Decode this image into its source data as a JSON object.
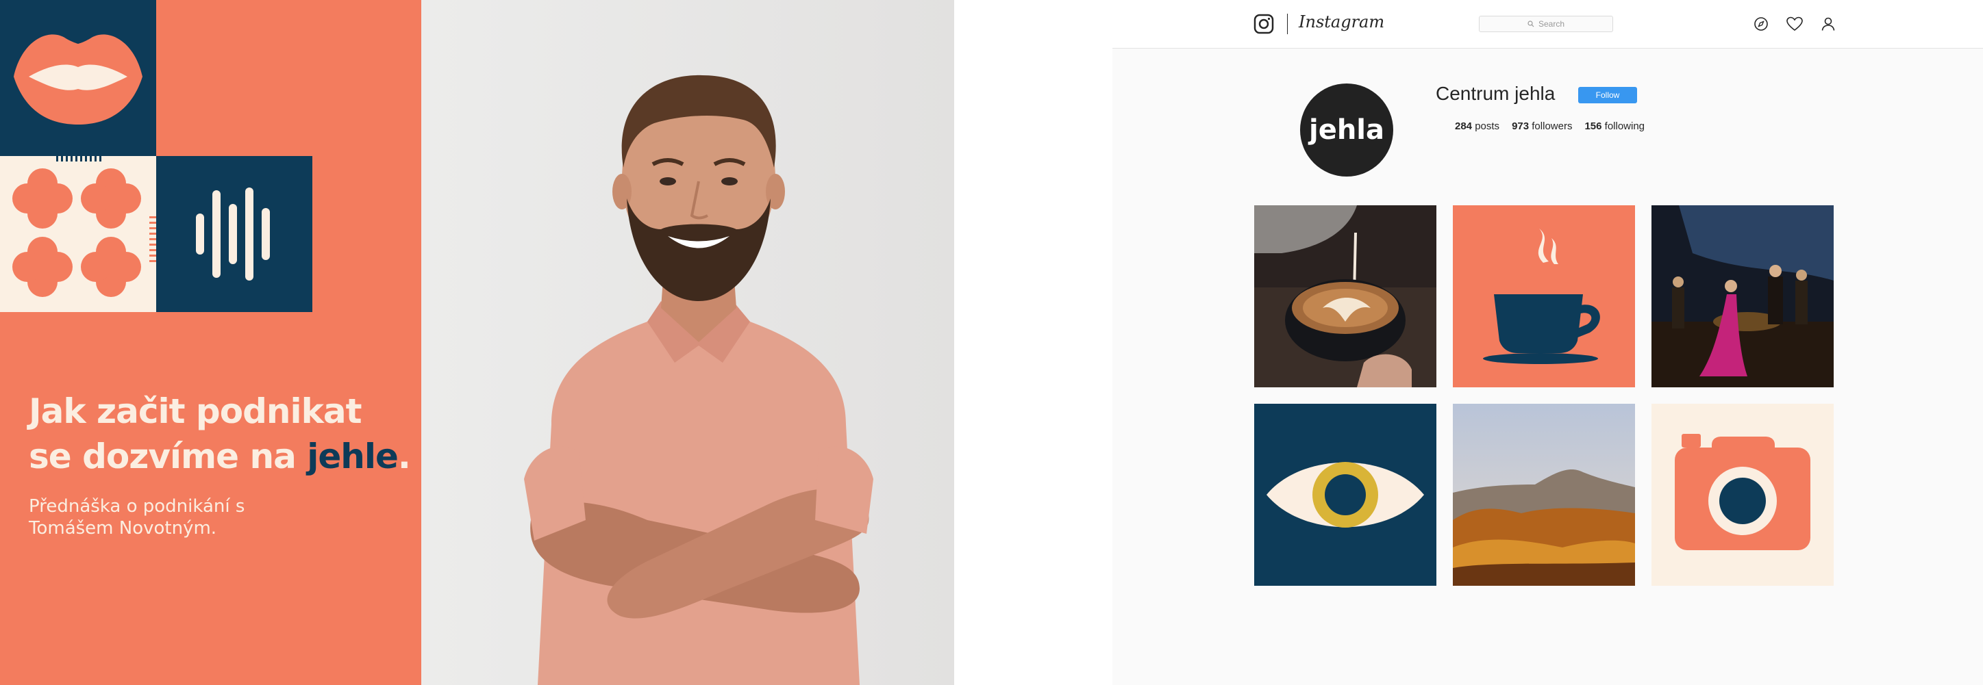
{
  "banner": {
    "headline_line1": "Jak začit podnikat",
    "headline_line2_prefix": "se dozvíme na ",
    "headline_brand": "jehle",
    "headline_period": ".",
    "subline_line1": "Přednáška o podnikání s",
    "subline_line2": "Tomášem Novotným.",
    "colors": {
      "coral": "#f37c5e",
      "navy": "#0d3b58",
      "cream": "#fbf0e3"
    }
  },
  "instagram": {
    "wordmark": "Instagram",
    "search_placeholder": "Search",
    "nav_icons": [
      "compass-icon",
      "heart-icon",
      "profile-icon"
    ],
    "profile": {
      "avatar_text": "jehla",
      "name": "Centrum jehla",
      "follow_label": "Follow",
      "stats": [
        {
          "value": "284",
          "label": "posts"
        },
        {
          "value": "973",
          "label": "followers"
        },
        {
          "value": "156",
          "label": "following"
        }
      ]
    },
    "posts": [
      "latte-art-photo",
      "coffee-cup-icon",
      "opera-stage-photo",
      "eye-icon",
      "autumn-landscape-photo",
      "camera-icon"
    ],
    "colors": {
      "follow_blue": "#3897f0"
    }
  }
}
